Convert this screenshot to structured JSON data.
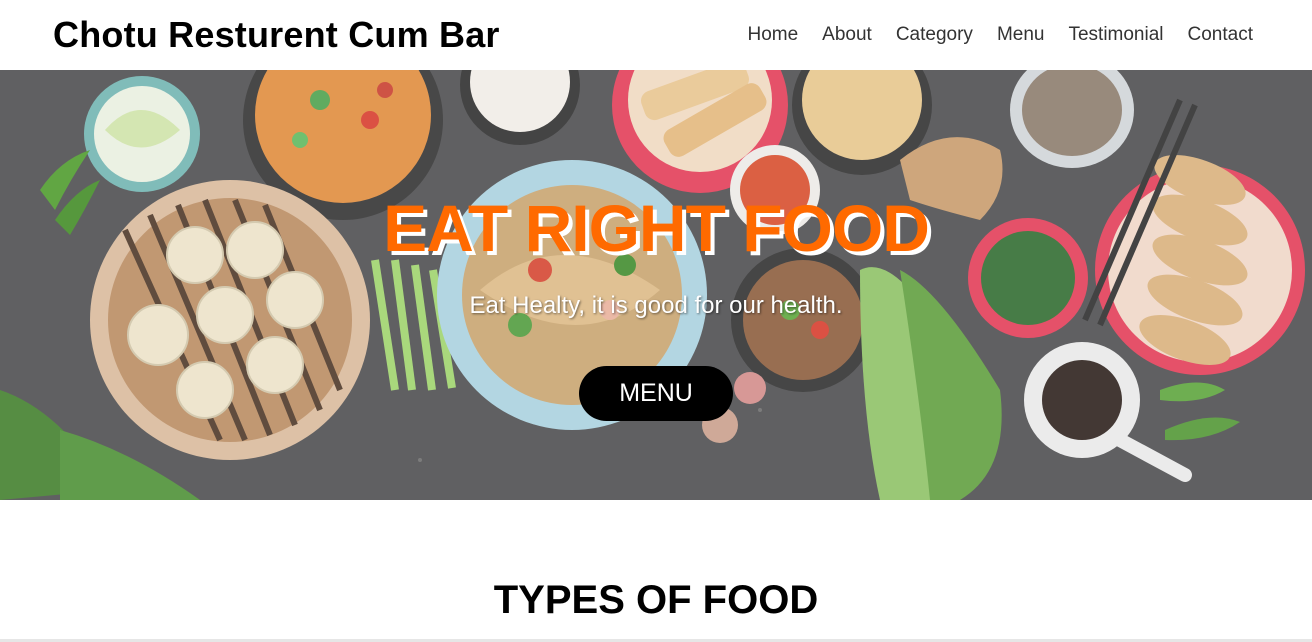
{
  "brand": {
    "name": "Chotu Resturent Cum Bar"
  },
  "nav": {
    "items": [
      {
        "label": "Home"
      },
      {
        "label": "About"
      },
      {
        "label": "Category"
      },
      {
        "label": "Menu"
      },
      {
        "label": "Testimonial"
      },
      {
        "label": "Contact"
      }
    ]
  },
  "hero": {
    "title": "EAT RIGHT FOOD",
    "subtitle": "Eat Healty, it is good for our health.",
    "button_label": "MENU",
    "title_color": "#ff6a00"
  },
  "section": {
    "title": "TYPES OF FOOD"
  }
}
